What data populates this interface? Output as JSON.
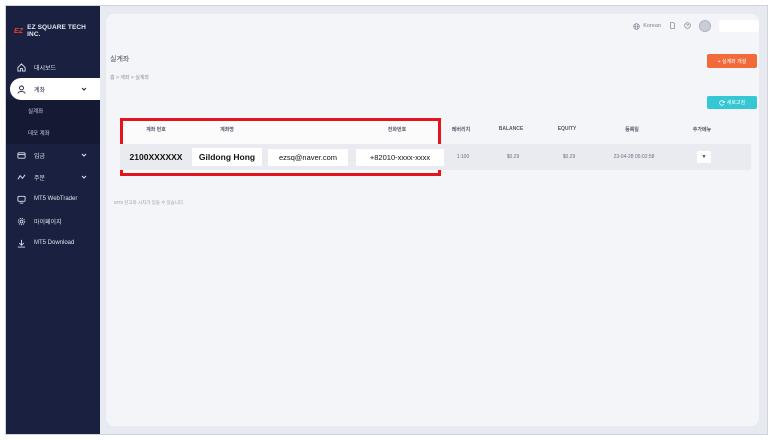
{
  "brand": {
    "mark": "EZ",
    "name": "EZ SQUARE TECH INC."
  },
  "sidebar": {
    "items": [
      {
        "label": "대시보드"
      },
      {
        "label": "계좌"
      },
      {
        "label": "입금"
      },
      {
        "label": "주문"
      },
      {
        "label": "MT5 WebTrader"
      },
      {
        "label": "마이페이지"
      },
      {
        "label": "MT5 Download"
      }
    ],
    "sub_items": [
      {
        "label": "실계좌"
      },
      {
        "label": "데모 계좌"
      }
    ]
  },
  "topbar": {
    "language": "Korean"
  },
  "page": {
    "title": "실계좌",
    "breadcrumb": "홈 > 계좌 > 실계좌",
    "open_button": "+ 실계좌 개설",
    "refresh_button": "새로고침",
    "notice": "MT5 잔고와 시차가 있을 수 있습니다."
  },
  "table": {
    "headers": [
      "계좌 번호",
      "계좌명",
      "",
      "전화번호",
      "레버리지",
      "BALANCE",
      "EQUITY",
      "등록일",
      "추가메뉴"
    ],
    "row": {
      "account_no": "2100XXXXXX",
      "name": "Gildong Hong",
      "email": "ezsq@naver.com",
      "phone": "+82010-xxxx-xxxx",
      "leverage": "1:100",
      "balance": "$0.29",
      "equity": "$0.29",
      "registered": "23-04-28 05:02:58",
      "more": "▼"
    }
  },
  "colors": {
    "sidebar_bg": "#1a2140",
    "primary_button": "#f36a3a",
    "refresh_button": "#35c7d3",
    "highlight_border": "#e5131b",
    "brand_mark": "#e8412c"
  }
}
